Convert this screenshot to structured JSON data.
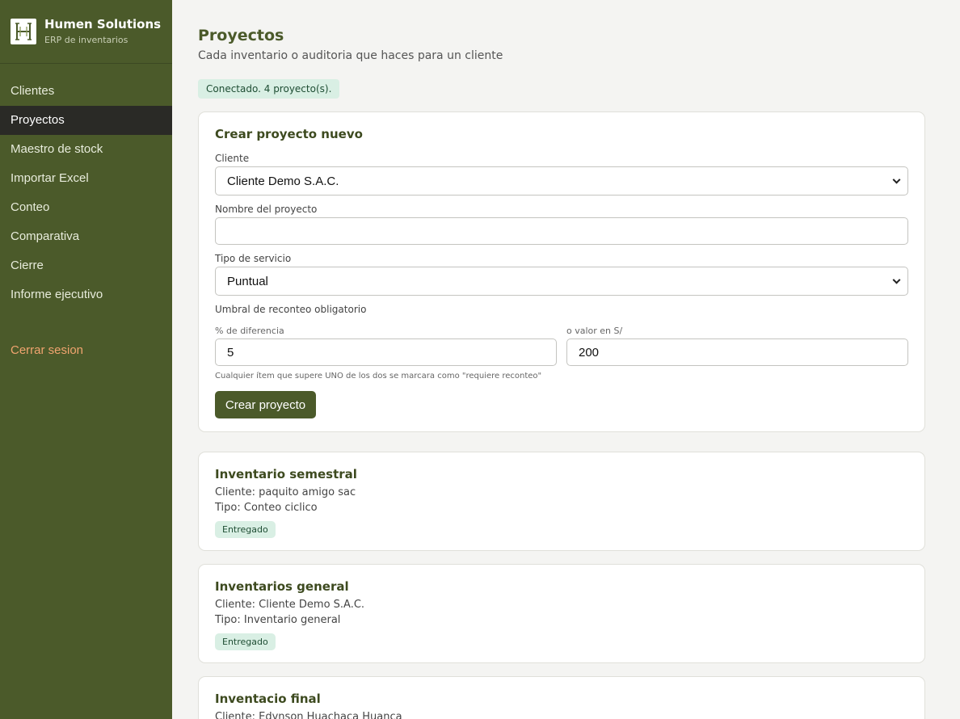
{
  "brand": {
    "name": "Humen Solutions",
    "subtitle": "ERP de inventarios"
  },
  "sidebar": {
    "items": [
      {
        "label": "Clientes"
      },
      {
        "label": "Proyectos"
      },
      {
        "label": "Maestro de stock"
      },
      {
        "label": "Importar Excel"
      },
      {
        "label": "Conteo"
      },
      {
        "label": "Comparativa"
      },
      {
        "label": "Cierre"
      },
      {
        "label": "Informe ejecutivo"
      }
    ],
    "active_item": "Proyectos",
    "logout_label": "Cerrar sesion"
  },
  "page": {
    "title": "Proyectos",
    "subtitle": "Cada inventario o auditoria que haces para un cliente",
    "status": "Conectado. 4 proyecto(s)."
  },
  "form": {
    "title": "Crear proyecto nuevo",
    "client_label": "Cliente",
    "client_value": "Cliente Demo S.A.C.",
    "name_label": "Nombre del proyecto",
    "name_value": "",
    "service_label": "Tipo de servicio",
    "service_value": "Puntual",
    "threshold_label": "Umbral de reconteo obligatorio",
    "percent_label": "% de diferencia",
    "percent_value": "5",
    "amount_label": "o valor en S/",
    "amount_value": "200",
    "hint": "Cualquier ítem que supere UNO de los dos se marcara como \"requiere reconteo\"",
    "submit_label": "Crear proyecto"
  },
  "projects": [
    {
      "title": "Inventario semestral",
      "client": "Cliente: paquito amigo sac",
      "type": "Tipo: Conteo ciclico",
      "status": "Entregado"
    },
    {
      "title": "Inventarios general",
      "client": "Cliente: Cliente Demo S.A.C.",
      "type": "Tipo: Inventario general",
      "status": "Entregado"
    },
    {
      "title": "Inventacio final",
      "client": "Cliente: Edynson Huachaca Huanca"
    }
  ],
  "colors": {
    "sidebar": "#4b5a2a",
    "active_nav": "#2a2a26",
    "accent": "#4b5a2a",
    "logout": "#f0a46f",
    "badge_bg": "#d9efe4"
  },
  "icons": {
    "logo": "humen-logo",
    "select": "chevron-down-icon"
  }
}
